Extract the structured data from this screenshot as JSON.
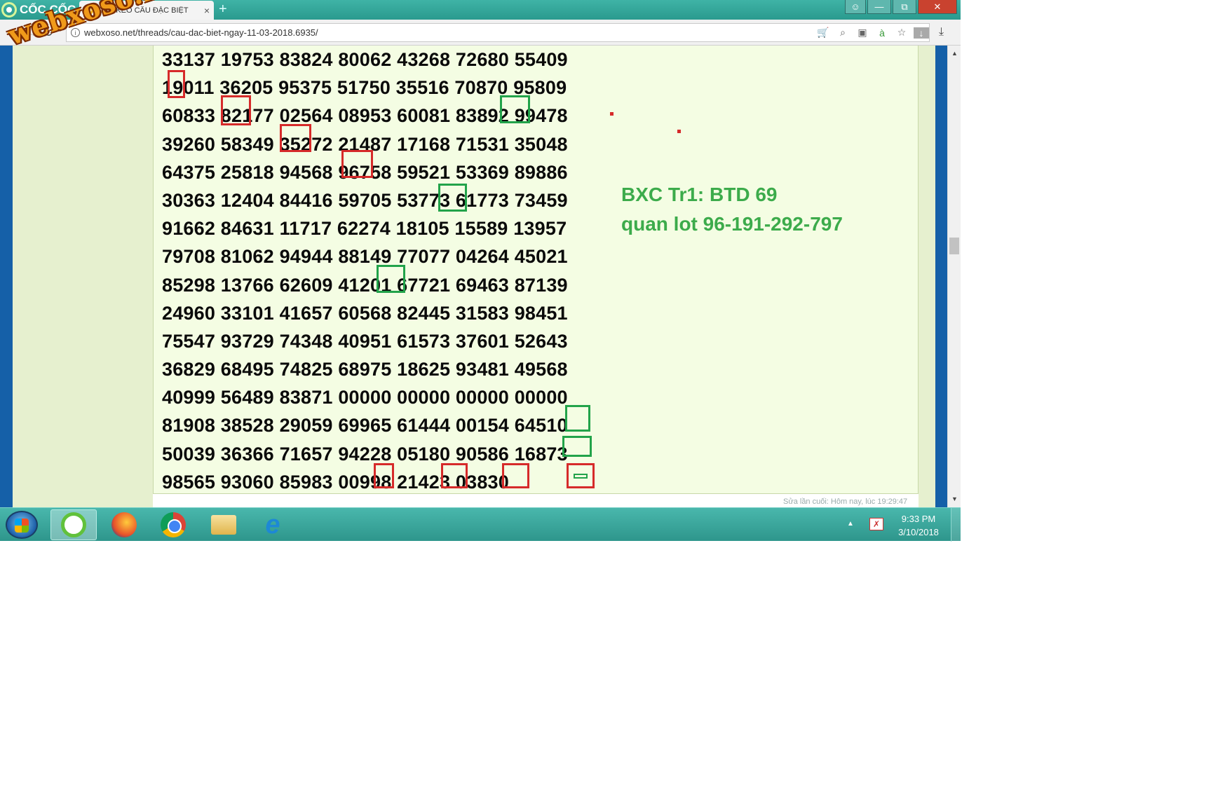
{
  "browser": {
    "brand": "CỐC CỐC",
    "tab_title": "CẦU KÈO CẦU ĐẶC BIỆT",
    "tab_favicon": "XS",
    "tab_close": "×",
    "new_tab": "+",
    "url": "webxoso.net/threads/cau-dac-biet-ngay-11-03-2018.6935/"
  },
  "watermark": "webxoso.net",
  "post": {
    "rows": [
      "33137 19753 83824 80062 43268 72680 55409",
      "19011 36205 95375 51750 35516 70870 95809",
      "60833 82177 02564 08953 60081 83892 99478",
      "39260 58349 35272 21487 17168 71531 35048",
      "64375 25818 94568 96758 59521 53369 89886",
      "30363 12404 84416 59705 53773 61773 73459",
      "91662 84631 11717 62274 18105 15589 13957",
      "79708 81062 94944 88149 77077 04264 45021",
      "85298 13766 62609 41201 67721 69463 87139",
      "24960 33101 41657 60568 82445 31583 98451",
      "75547 93729 74348 40951 61573 37601 52643",
      "36829 68495 74825 68975 18625 93481 49568",
      "40999 56489 83871 00000 00000 00000 00000",
      "81908 38528 29059 69965 61444 00154 64510",
      "50039 36366 71657 94228 05180 90586 16873",
      "98565 93060 85983 00998 21423 03830"
    ],
    "note_line1": "BXC Tr1: BTD 69",
    "note_line2": "quan lot 96-191-292-797",
    "edited": "Sửa lần cuối: Hôm nay, lúc 19:29:47",
    "colors": {
      "highlight_red": "#d62a2a",
      "highlight_green": "#22a34a",
      "note_green": "#3cab4b"
    }
  },
  "taskbar": {
    "time": "9:33 PM",
    "date": "3/10/2018"
  }
}
